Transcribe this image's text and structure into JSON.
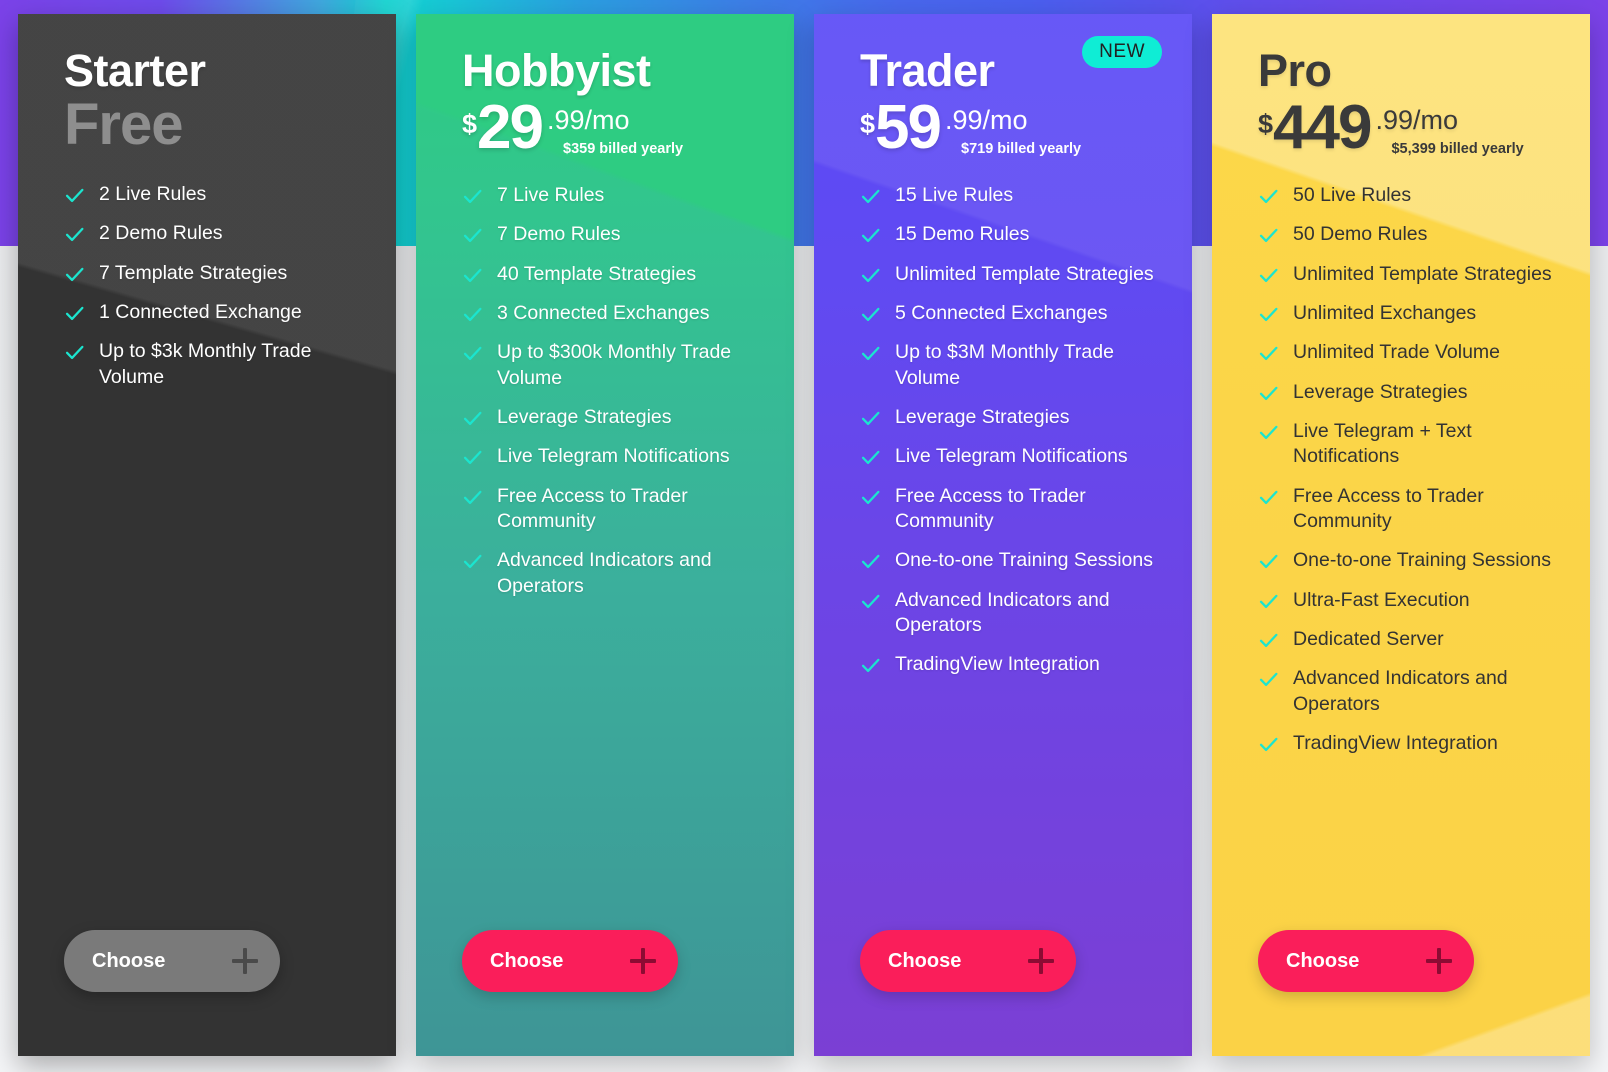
{
  "theme": {
    "cta_color": "#FA1E5A",
    "check_color": "#1BE5CF",
    "badge_color": "#0FEDD5",
    "starter_color": "#333333",
    "hobbyist_color": "#2ECC82",
    "trader_color": "#5B4BF6",
    "pro_color": "#FCD849"
  },
  "plans": [
    {
      "id": "starter",
      "name": "Starter",
      "price_word": "Free",
      "currency": "",
      "amount": "",
      "cents": "",
      "billed_yearly": "",
      "badge": "",
      "cta_label": "Choose",
      "features": [
        "2 Live Rules",
        "2 Demo Rules",
        "7 Template Strategies",
        "1 Connected Exchange",
        "Up to $3k Monthly Trade Volume"
      ]
    },
    {
      "id": "hobbyist",
      "name": "Hobbyist",
      "price_word": "",
      "currency": "$",
      "amount": "29",
      "cents": ".99/mo",
      "billed_yearly": "$359 billed yearly",
      "badge": "",
      "cta_label": "Choose",
      "features": [
        "7 Live Rules",
        "7 Demo Rules",
        "40 Template Strategies",
        "3 Connected Exchanges",
        "Up to $300k Monthly Trade Volume",
        "Leverage Strategies",
        "Live Telegram Notifications",
        "Free Access to Trader Community",
        "Advanced Indicators and Operators"
      ]
    },
    {
      "id": "trader",
      "name": "Trader",
      "price_word": "",
      "currency": "$",
      "amount": "59",
      "cents": ".99/mo",
      "billed_yearly": "$719 billed yearly",
      "badge": "NEW",
      "cta_label": "Choose",
      "features": [
        "15 Live Rules",
        "15 Demo Rules",
        "Unlimited Template Strategies",
        "5 Connected Exchanges",
        "Up to $3M Monthly Trade Volume",
        "Leverage Strategies",
        "Live Telegram Notifications",
        "Free Access to Trader Community",
        "One-to-one Training Sessions",
        "Advanced Indicators and Operators",
        "TradingView Integration"
      ]
    },
    {
      "id": "pro",
      "name": "Pro",
      "price_word": "",
      "currency": "$",
      "amount": "449",
      "cents": ".99/mo",
      "billed_yearly": "$5,399 billed yearly",
      "badge": "",
      "cta_label": "Choose",
      "features": [
        "50 Live Rules",
        "50 Demo Rules",
        "Unlimited Template Strategies",
        "Unlimited Exchanges",
        "Unlimited Trade Volume",
        "Leverage Strategies",
        "Live Telegram + Text Notifications",
        "Free Access to Trader Community",
        "One-to-one Training Sessions",
        "Ultra-Fast Execution",
        "Dedicated Server",
        "Advanced Indicators and Operators",
        "TradingView Integration"
      ]
    }
  ]
}
